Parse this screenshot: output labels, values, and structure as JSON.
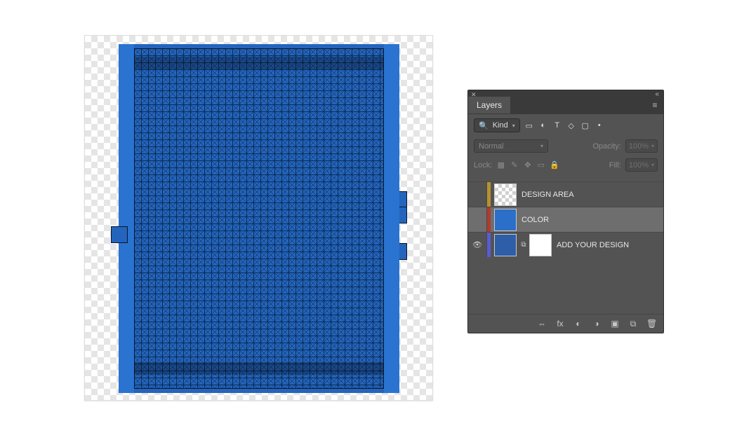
{
  "panel": {
    "title": "Layers",
    "filter": {
      "label": "Kind"
    },
    "blend": {
      "mode": "Normal",
      "opacityLabel": "Opacity:",
      "opacityValue": "100%"
    },
    "lock": {
      "label": "Lock:",
      "fillLabel": "Fill:",
      "fillValue": "100%"
    },
    "layers": [
      {
        "name": "DESIGN AREA",
        "swatch": "#b7932b",
        "thumb": "trans",
        "selected": false,
        "visible": false
      },
      {
        "name": "COLOR",
        "swatch": "#b03a2e",
        "thumb": "blue",
        "selected": true,
        "visible": false
      },
      {
        "name": "ADD YOUR DESIGN",
        "swatch": "#5b5bd6",
        "thumb": "add",
        "selected": false,
        "visible": true,
        "mask": true
      }
    ],
    "footerIcons": {
      "link": "⇔",
      "fx": "fx",
      "mask": "◐",
      "adj": "◑",
      "group": "▣",
      "new": "⧉",
      "trash": "🗑"
    },
    "filterIcons": {
      "image": "▭",
      "adjust": "◐",
      "type": "T",
      "shape": "◇",
      "smart": "▢",
      "art": "•"
    }
  }
}
